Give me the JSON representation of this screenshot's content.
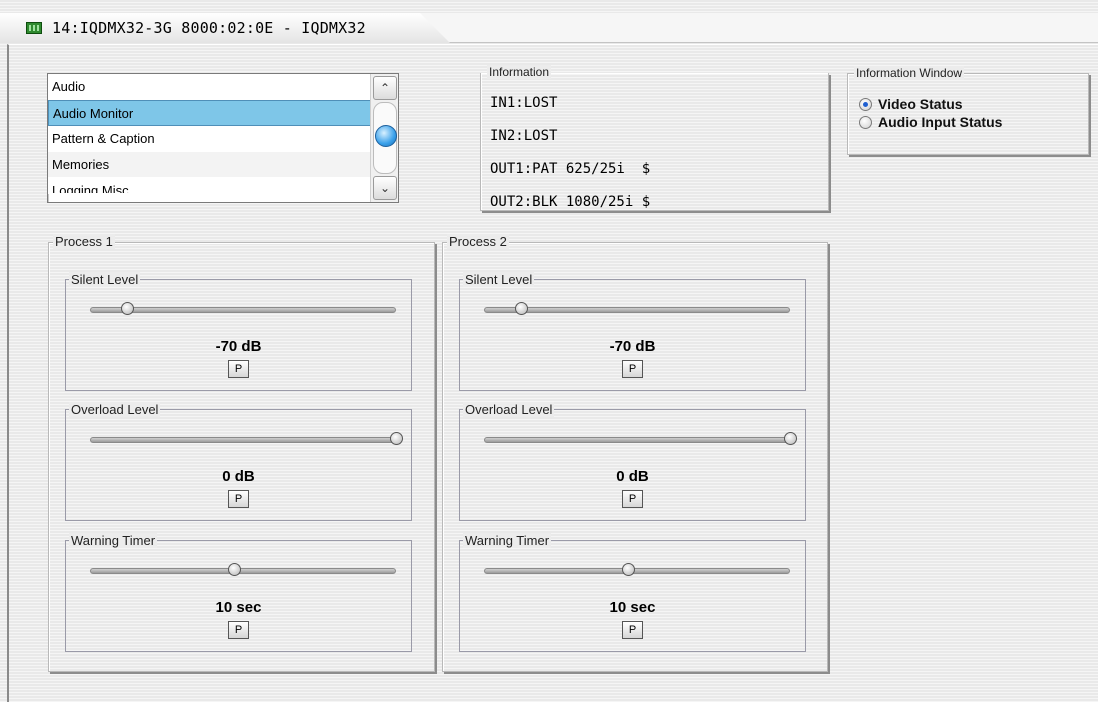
{
  "window": {
    "title": "14:IQDMX32-3G  8000:02:0E  - IQDMX32"
  },
  "menu_list": {
    "items": [
      "Audio",
      "Audio Monitor",
      "Pattern & Caption",
      "Memories",
      "Logging Misc"
    ],
    "selected": "Audio Monitor"
  },
  "information": {
    "legend": "Information",
    "lines": [
      "IN1:LOST",
      "IN2:LOST",
      "OUT1:PAT 625/25i  $",
      "OUT2:BLK 1080/25i $"
    ]
  },
  "information_window": {
    "legend": "Information Window",
    "options": [
      "Video Status",
      "Audio Input Status"
    ],
    "selected": "Video Status"
  },
  "processes": [
    {
      "legend": "Process 1",
      "silent_level": {
        "label": "Silent Level",
        "value": "-70 dB",
        "position": 0.12
      },
      "overload_level": {
        "label": "Overload Level",
        "value": "0 dB",
        "position": 1.0
      },
      "warning_timer": {
        "label": "Warning Timer",
        "value": "10 sec",
        "position": 0.47
      },
      "preset_label": "P"
    },
    {
      "legend": "Process 2",
      "silent_level": {
        "label": "Silent Level",
        "value": "-70 dB",
        "position": 0.12
      },
      "overload_level": {
        "label": "Overload Level",
        "value": "0 dB",
        "position": 1.0
      },
      "warning_timer": {
        "label": "Warning Timer",
        "value": "10 sec",
        "position": 0.47
      },
      "preset_label": "P"
    }
  ],
  "icons": {
    "title_icon": "device-board-icon",
    "scroll_up": "chevron-up-icon",
    "scroll_down": "chevron-down-icon"
  },
  "colors": {
    "selection": "#7ec6e8",
    "scroll_thumb": "#39a0ea",
    "radio_dot": "#1f5fd0",
    "title_icon": "#2f8a2f"
  }
}
